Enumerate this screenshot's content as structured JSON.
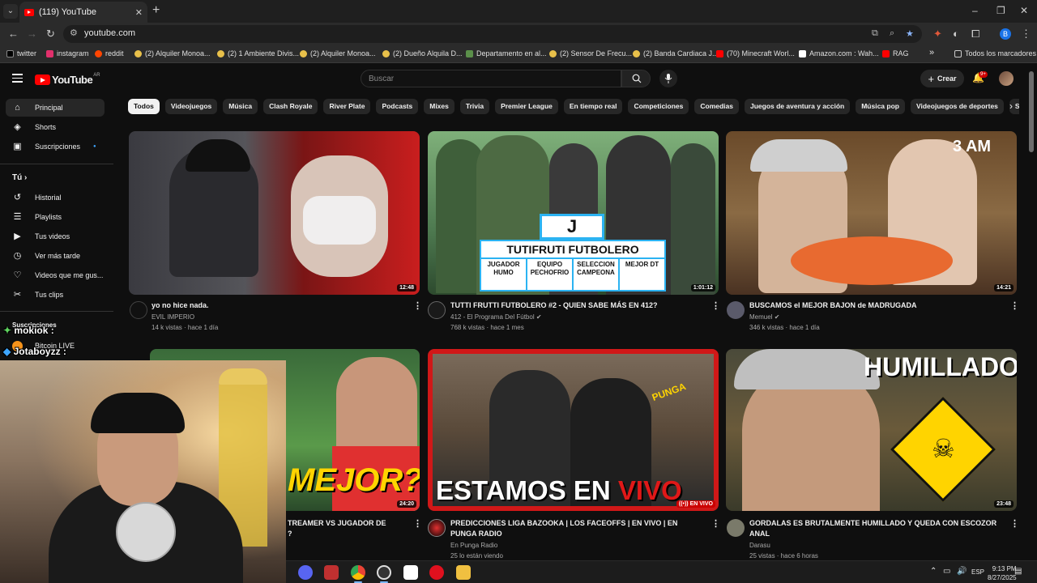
{
  "browser": {
    "tab_title": "(119) YouTube",
    "url": "youtube.com",
    "bookmarks": [
      {
        "label": "twitter",
        "color": "#000000"
      },
      {
        "label": "instagram",
        "color": "#e1306c"
      },
      {
        "label": "reddit",
        "color": "#ff4500"
      },
      {
        "label": "(2) Alquiler Monoa...",
        "color": "#e8c04a"
      },
      {
        "label": "(2) 1 Ambiente Divis...",
        "color": "#e8c04a"
      },
      {
        "label": "(2) Alquiler Monoa...",
        "color": "#e8c04a"
      },
      {
        "label": "(2) Dueño Alquila D...",
        "color": "#e8c04a"
      },
      {
        "label": "Departamento en al...",
        "color": "#5b8f4a"
      },
      {
        "label": "(2) Sensor De Frecu...",
        "color": "#e8c04a"
      },
      {
        "label": "(2) Banda Cardiaca J...",
        "color": "#e8c04a"
      },
      {
        "label": "(70) Minecraft Worl...",
        "color": "#ff0000"
      },
      {
        "label": "Amazon.com : Wah...",
        "color": "#ffffff"
      },
      {
        "label": "RAG",
        "color": "#ff0000"
      }
    ],
    "bookmarks_more": "»",
    "all_bookmarks": "Todos los marcadores",
    "profile_initial": "B"
  },
  "youtube": {
    "logo_text": "YouTube",
    "country": "AR",
    "search_placeholder": "Buscar",
    "create_label": "Crear",
    "notif_count": "9+",
    "sidebar": {
      "main": [
        {
          "label": "Principal",
          "icon": "home-icon",
          "glyph": "⌂"
        },
        {
          "label": "Shorts",
          "icon": "shorts-icon",
          "glyph": "◈"
        },
        {
          "label": "Suscripciones",
          "icon": "subscriptions-icon",
          "glyph": "▣"
        }
      ],
      "you_heading": "Tú",
      "you": [
        {
          "label": "Historial",
          "icon": "history-icon",
          "glyph": "↺"
        },
        {
          "label": "Playlists",
          "icon": "playlists-icon",
          "glyph": "☰"
        },
        {
          "label": "Tus videos",
          "icon": "your-videos-icon",
          "glyph": "▶"
        },
        {
          "label": "Ver más tarde",
          "icon": "watch-later-icon",
          "glyph": "◷"
        },
        {
          "label": "Videos que me gus...",
          "icon": "liked-icon",
          "glyph": "👍"
        },
        {
          "label": "Tus clips",
          "icon": "clips-icon",
          "glyph": "✂"
        }
      ],
      "subs_heading": "Suscripciones",
      "sub_channel": "Bitcoin LIVE"
    },
    "chips": [
      "Todos",
      "Videojuegos",
      "Música",
      "Clash Royale",
      "River Plate",
      "Podcasts",
      "Mixes",
      "Trivia",
      "Premier League",
      "En tiempo real",
      "Competiciones",
      "Comedias",
      "Juegos de aventura y acción",
      "Música pop",
      "Videojuegos de deportes",
      "Subidos re"
    ],
    "videos": [
      {
        "title": "yo no hice nada.",
        "channel": "EVIL IMPERIO",
        "meta": "14 k vistas · hace 1 día",
        "duration": "12:48",
        "verified": false
      },
      {
        "title": "TUTTI FRUTTI FUTBOLERO #2 - QUIEN SABE MÁS EN 412?",
        "channel": "412 - El Programa Del Fútbol",
        "meta": "768 k vistas · hace 1 mes",
        "duration": "1:01:12",
        "verified": true
      },
      {
        "title": "BUSCAMOS el MEJOR BAJON de MADRUGADA",
        "channel": "Memuel",
        "meta": "346 k vistas · hace 1 día",
        "duration": "14:21",
        "verified": true
      },
      {
        "title": "TREAMER VS JUGADOR DE",
        "title2": "?",
        "channel": "",
        "meta": "",
        "duration": "24:20",
        "verified": false
      },
      {
        "title": "PREDICCIONES LIGA BAZOOKA | LOS FACEOFFS | EN VIVO | EN PUNGA RADIO",
        "channel": "En Punga Radio",
        "meta": "25 lo están viendo",
        "duration": "EN VIVO",
        "verified": false
      },
      {
        "title": "GORDALAS ES BRUTALMENTE HUMILLADO Y QUEDA CON ESCOZOR ANAL",
        "channel": "Darasu",
        "meta": "25 vistas · hace 6 horas",
        "duration": "23:48",
        "verified": false
      }
    ],
    "thumb_text": {
      "card_letter": "J",
      "card_title": "TUTIFRUTI FUTBOLERO",
      "card_cols": [
        "JUGADOR HUMO",
        "EQUIPO PECHOFRIO",
        "SELECCION CAMPEONA",
        "MEJOR DT"
      ],
      "am": "3 AM",
      "mejor": "MEJOR?",
      "estamos": "ESTAMOS EN",
      "vivo": "VIVO",
      "humillado": "HUMILLADO",
      "punga": "PUNGA"
    }
  },
  "stream_overlay": {
    "chat1": "mokiok :",
    "chat2": "Jotaboyzz :"
  },
  "taskbar": {
    "lang": "ESP",
    "time": "9:13 PM",
    "date": "8/27/2025"
  }
}
